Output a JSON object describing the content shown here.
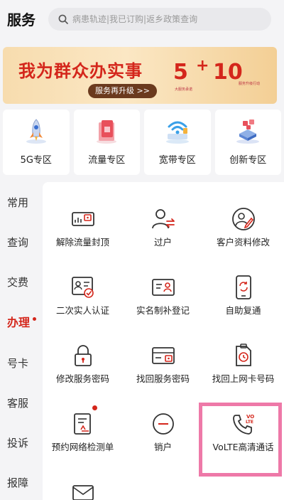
{
  "header": {
    "title": "服务",
    "search_placeholder": "病患轨迹|我已订购|返乡政策查询"
  },
  "banner": {
    "title": "我为群众办实事",
    "button_label": "服务再升级 >>",
    "num_left": "5",
    "plus": "+",
    "num_right": "10",
    "caption_left": "大服务承诺",
    "caption_right": "服务升级行动"
  },
  "zones": [
    {
      "label": "5G专区",
      "icon": "rocket-icon"
    },
    {
      "label": "流量专区",
      "icon": "data-package-icon"
    },
    {
      "label": "宽带专区",
      "icon": "wifi-icon"
    },
    {
      "label": "创新专区",
      "icon": "innovation-blocks-icon"
    }
  ],
  "tabs": [
    {
      "label": "常用"
    },
    {
      "label": "查询"
    },
    {
      "label": "交费"
    },
    {
      "label": "办理",
      "active": true
    },
    {
      "label": "号卡"
    },
    {
      "label": "客服"
    },
    {
      "label": "投诉"
    },
    {
      "label": "报障"
    }
  ],
  "services": [
    {
      "label": "解除流量封顶",
      "icon": "unlock-data-icon"
    },
    {
      "label": "过户",
      "icon": "transfer-user-icon"
    },
    {
      "label": "客户资料修改",
      "icon": "edit-profile-icon"
    },
    {
      "label": "二次实人认证",
      "icon": "id-verify-icon"
    },
    {
      "label": "实名制补登记",
      "icon": "real-name-register-icon"
    },
    {
      "label": "自助复通",
      "icon": "phone-restore-icon"
    },
    {
      "label": "修改服务密码",
      "icon": "lock-icon"
    },
    {
      "label": "找回服务密码",
      "icon": "card-lock-icon"
    },
    {
      "label": "找回上网卡号码",
      "icon": "sim-clock-icon"
    },
    {
      "label": "预约网络检测单",
      "icon": "form-check-icon",
      "badge": true
    },
    {
      "label": "销户",
      "icon": "minus-circle-icon"
    },
    {
      "label": "VoLTE高清通话",
      "icon": "volte-phone-icon",
      "volte_text": "VO\nLTE"
    }
  ],
  "colors": {
    "brand_red": "#d4261b",
    "highlight_pink": "#ee79a8"
  }
}
